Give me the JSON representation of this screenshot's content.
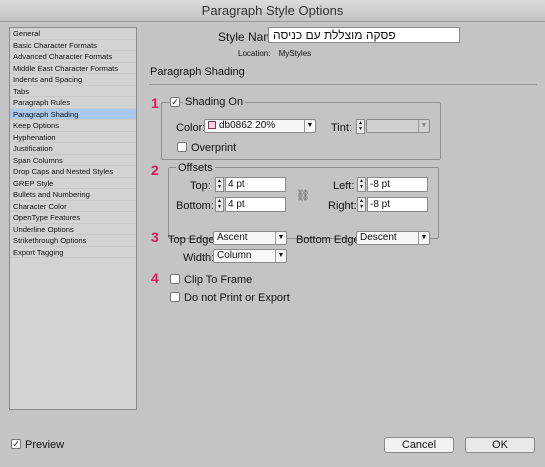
{
  "window": {
    "title": "Paragraph Style Options"
  },
  "sidebar": {
    "items": [
      "General",
      "Basic Character Formats",
      "Advanced Character Formats",
      "Middle East Character Formats",
      "Indents and Spacing",
      "Tabs",
      "Paragraph Rules",
      "Paragraph Shading",
      "Keep Options",
      "Hyphenation",
      "Justification",
      "Span Columns",
      "Drop Caps and Nested Styles",
      "GREP Style",
      "Bullets and Numbering",
      "Character Color",
      "OpenType Features",
      "Underline Options",
      "Strikethrough Options",
      "Export Tagging"
    ],
    "selected_index": 7
  },
  "header": {
    "style_name_label": "Style Name:",
    "style_name_value": "פסקה מוצללת עם כניסה",
    "location_label": "Location:",
    "location_value": "MyStyles",
    "section_title": "Paragraph Shading"
  },
  "steps": [
    "1",
    "2",
    "3",
    "4"
  ],
  "shading": {
    "shading_on_label": "Shading On",
    "shading_on_checked": true,
    "color_label": "Color:",
    "color_value": "db0862 20%",
    "tint_label": "Tint:",
    "tint_value": "",
    "overprint_label": "Overprint",
    "overprint_checked": false
  },
  "offsets": {
    "title": "Offsets",
    "top_label": "Top:",
    "top_value": "4 pt",
    "bottom_label": "Bottom:",
    "bottom_value": "4 pt",
    "left_label": "Left:",
    "left_value": "-8 pt",
    "right_label": "Right:",
    "right_value": "-8 pt"
  },
  "edges": {
    "top_edge_label": "Top Edge:",
    "top_edge_value": "Ascent",
    "bottom_edge_label": "Bottom Edge:",
    "bottom_edge_value": "Descent",
    "width_label": "Width:",
    "width_value": "Column"
  },
  "options": {
    "clip_label": "Clip To Frame",
    "clip_checked": false,
    "noprint_label": "Do not Print or Export",
    "noprint_checked": false
  },
  "footer": {
    "preview_label": "Preview",
    "preview_checked": true,
    "cancel_label": "Cancel",
    "ok_label": "OK"
  },
  "colors": {
    "step_accent": "#e0195b",
    "selection": "#a9c9ee"
  }
}
